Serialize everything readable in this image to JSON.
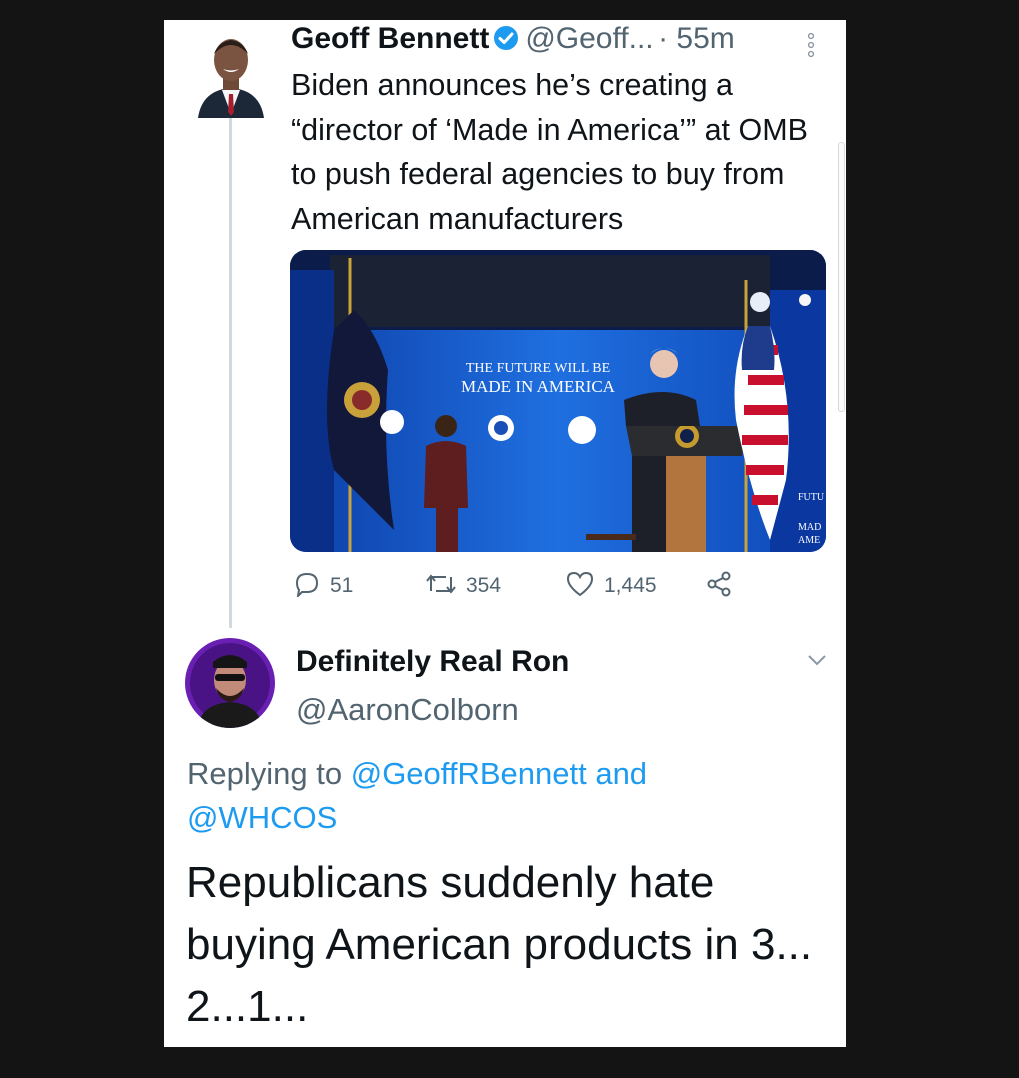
{
  "tweet": {
    "author_name": "Geoff Bennett",
    "author_handle": "@Geoff...",
    "time": "· 55m",
    "text": "Biden announces he’s creating a “director of ‘Made in America’” at OMB to push federal agencies to buy from American manufacturers",
    "image": {
      "banner_line1": "THE FUTURE WILL BE",
      "banner_line2": "MADE IN AMERICA",
      "side_line1": "FUTU",
      "side_line2": "MAD",
      "side_line3": "AME"
    },
    "actions": {
      "replies": "51",
      "retweets": "354",
      "likes": "1,445"
    }
  },
  "reply": {
    "author_name": "Definitely Real Ron",
    "author_handle": "@AaronColborn",
    "replying_prefix": "Replying to",
    "mention1": "@GeoffRBennett",
    "joiner": "and",
    "mention2": "@WHCOS",
    "text": "Republicans suddenly hate buying American products in 3... 2...1..."
  },
  "colors": {
    "background": "#141414",
    "card": "#ffffff",
    "link": "#1d9bf0",
    "verified": "#1d9bf0",
    "muted_text": "#536471"
  },
  "icons": [
    "verified-badge-icon",
    "more-dots-icon",
    "reply-icon",
    "retweet-icon",
    "like-icon",
    "share-icon",
    "chevron-down-icon"
  ]
}
